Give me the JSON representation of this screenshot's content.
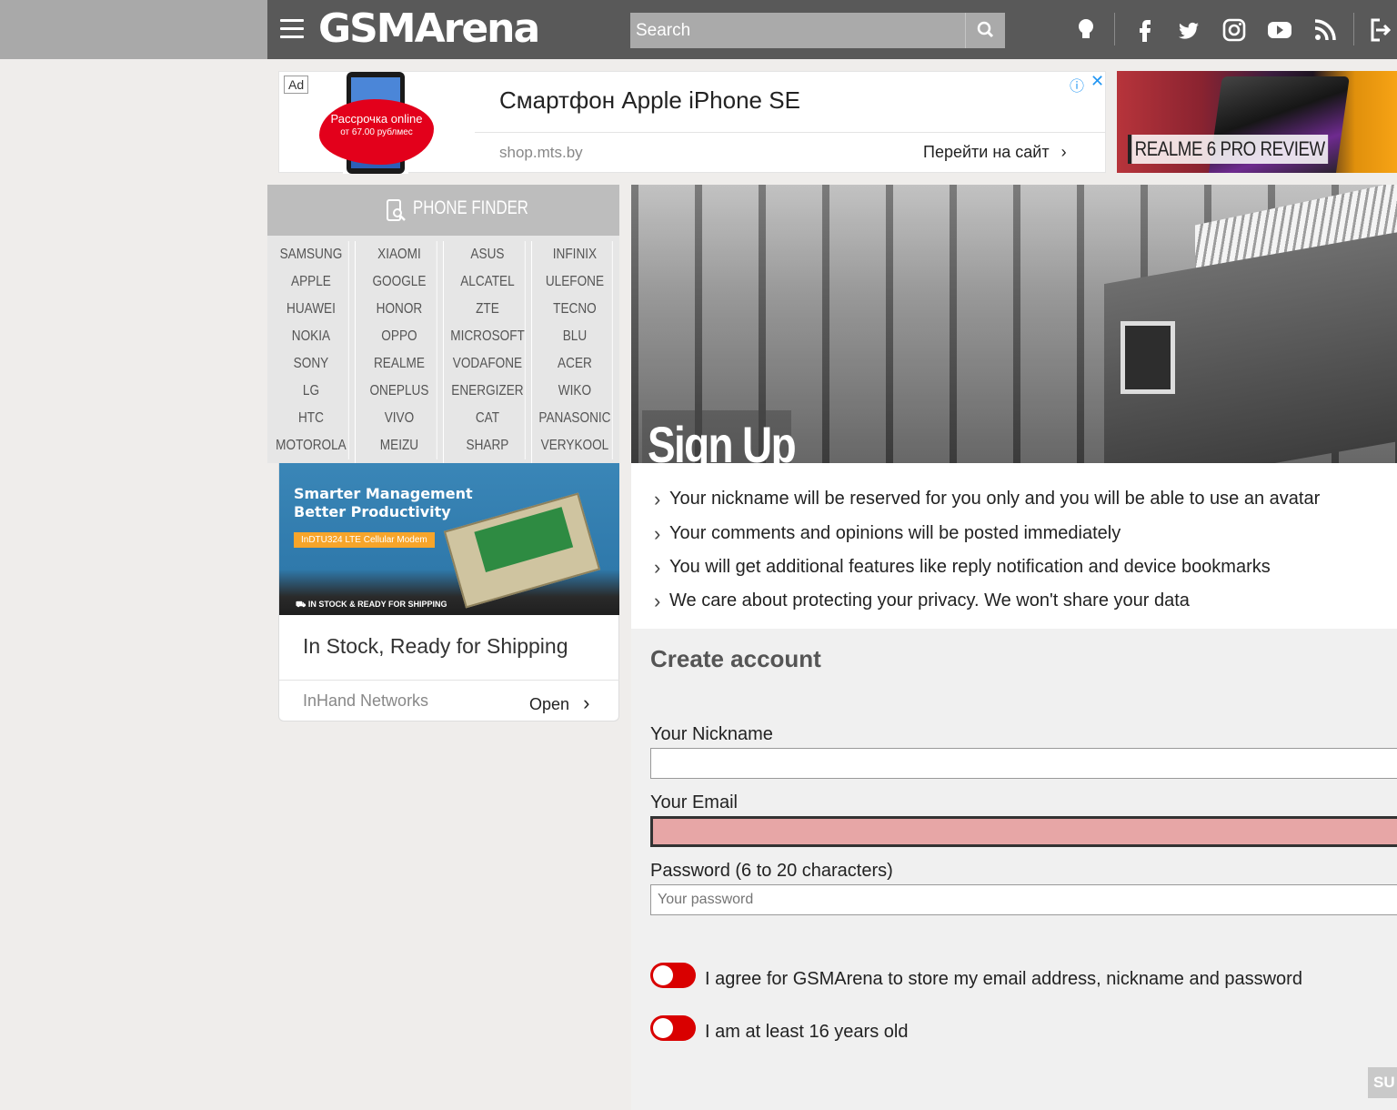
{
  "header": {
    "logo": "GSMArena",
    "search_placeholder": "Search"
  },
  "ad_top": {
    "badge": "Ad",
    "promo_line1": "Рассрочка online",
    "promo_line2": "от 67.00 рублмес",
    "title": "Смартфон Apple iPhone SE",
    "url": "shop.mts.by",
    "cta": "Перейти на сайт"
  },
  "review": {
    "label": "REALME 6 PRO REVIEW"
  },
  "phone_finder": {
    "title": "PHONE FINDER",
    "brands": [
      "SAMSUNG",
      "XIAOMI",
      "ASUS",
      "INFINIX",
      "APPLE",
      "GOOGLE",
      "ALCATEL",
      "ULEFONE",
      "HUAWEI",
      "HONOR",
      "ZTE",
      "TECNO",
      "NOKIA",
      "OPPO",
      "MICROSOFT",
      "BLU",
      "SONY",
      "REALME",
      "VODAFONE",
      "ACER",
      "LG",
      "ONEPLUS",
      "ENERGIZER",
      "WIKO",
      "HTC",
      "VIVO",
      "CAT",
      "PANASONIC",
      "MOTOROLA",
      "MEIZU",
      "SHARP",
      "VERYKOOL"
    ]
  },
  "ad_left": {
    "headline1": "Smarter Management",
    "headline2": "Better Productivity",
    "pill": "InDTU324 LTE Cellular Modem",
    "stock": "IN STOCK & READY FOR SHIPPING",
    "title": "In Stock, Ready for Shipping",
    "brand": "InHand Networks",
    "open": "Open"
  },
  "signup": {
    "hero_title": "Sign Up",
    "benefits": [
      "Your nickname will be reserved for you only and you will be able to use an avatar",
      "Your comments and opinions will be posted immediately",
      "You will get additional features like reply notification and device bookmarks",
      "We care about protecting your privacy. We won't share your data"
    ],
    "create_title": "Create account",
    "nickname_label": "Your Nickname",
    "email_label": "Your Email",
    "password_label": "Password (6 to 20 characters)",
    "password_placeholder": "Your password",
    "agree_label": "I agree for GSMArena to store my email address, nickname and password",
    "age_label": "I am at least 16 years old",
    "submit": "SU"
  },
  "colors": {
    "header_bg": "#595959",
    "toggle_off": "#d90000",
    "email_error_bg": "#e7a6a6"
  }
}
